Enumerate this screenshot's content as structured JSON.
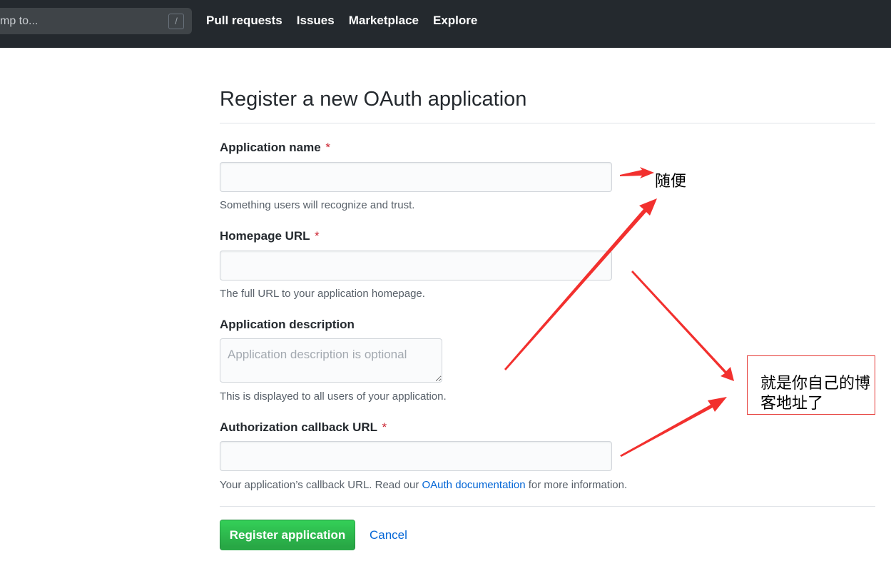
{
  "header": {
    "search_placeholder": "mp to...",
    "search_shortcut": "/",
    "nav": [
      "Pull requests",
      "Issues",
      "Marketplace",
      "Explore"
    ]
  },
  "page": {
    "title": "Register a new OAuth application"
  },
  "form": {
    "app_name": {
      "label": "Application name",
      "required": "*",
      "value": "",
      "note": "Something users will recognize and trust."
    },
    "homepage": {
      "label": "Homepage URL",
      "required": "*",
      "value": "",
      "note": "The full URL to your application homepage."
    },
    "description": {
      "label": "Application description",
      "placeholder": "Application description is optional",
      "note": "This is displayed to all users of your application."
    },
    "callback": {
      "label": "Authorization callback URL",
      "required": "*",
      "value": "",
      "note_prefix": "Your application’s callback URL. Read our ",
      "note_link": "OAuth documentation",
      "note_suffix": " for more information."
    },
    "submit_label": "Register application",
    "cancel_label": "Cancel"
  },
  "annotations": {
    "note1": "随便",
    "note2": "就是你自己的博客地址了",
    "color": "#f2302e"
  }
}
